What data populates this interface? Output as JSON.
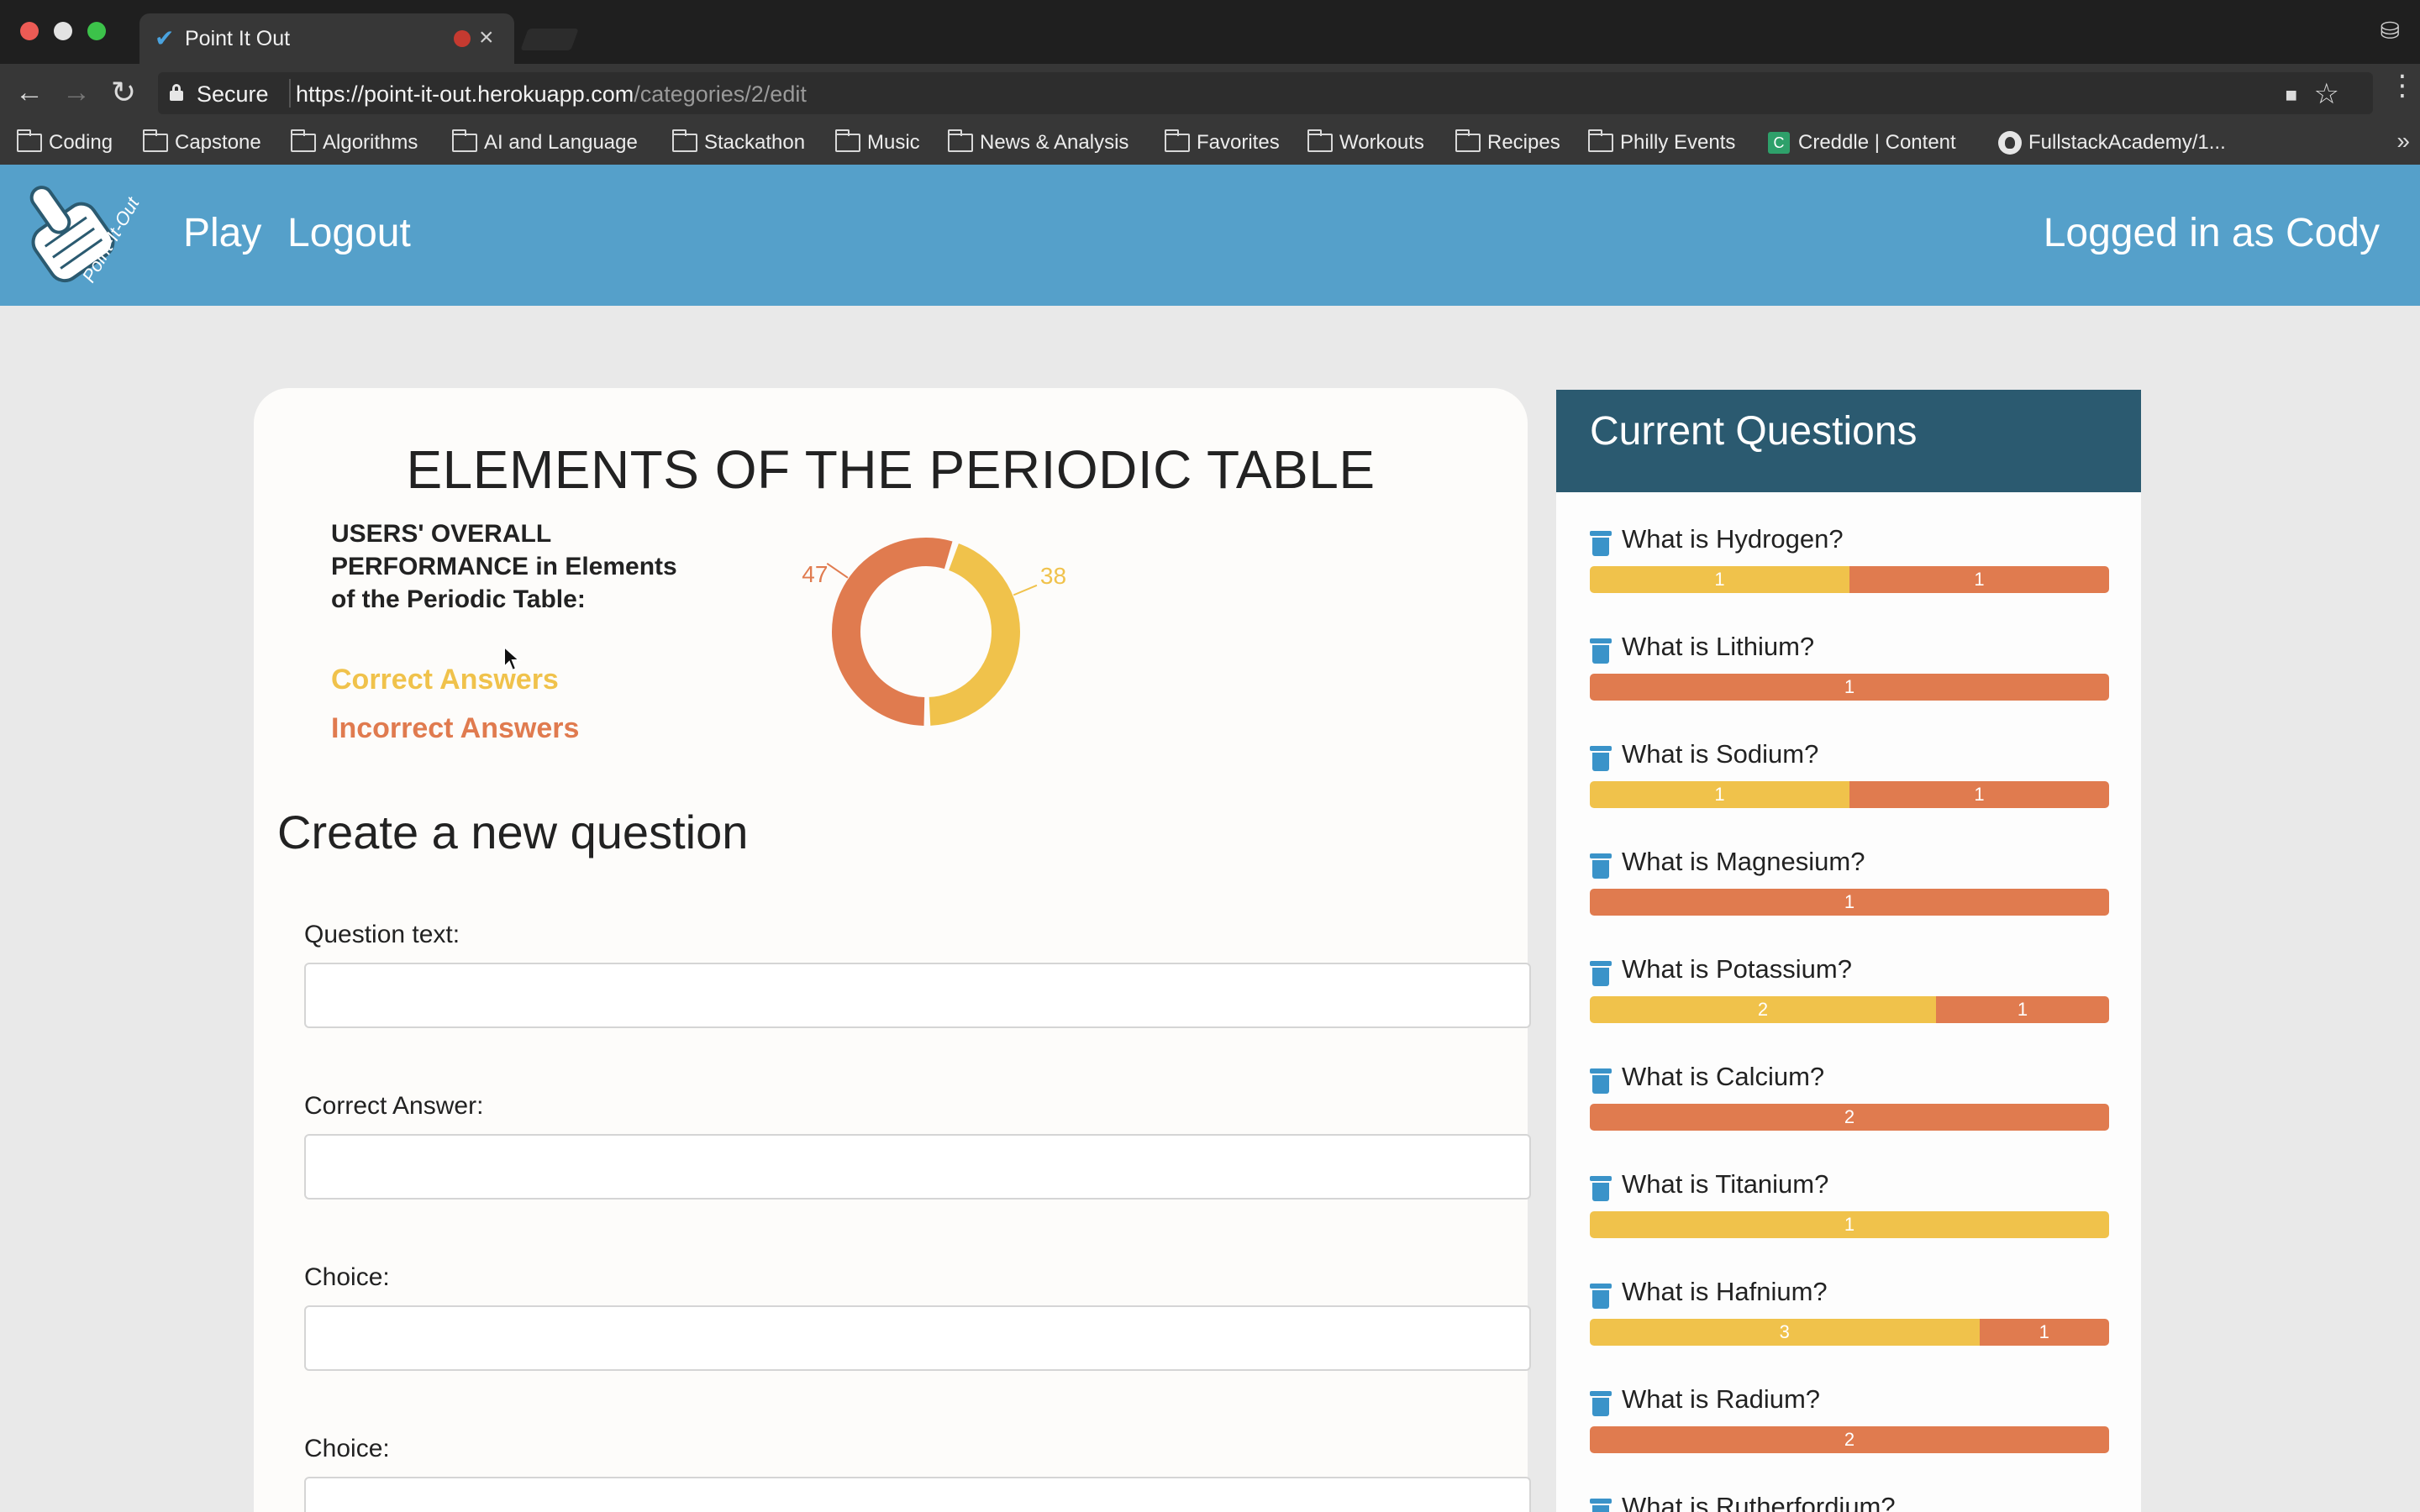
{
  "browser": {
    "tab_title": "Point It Out",
    "secure_label": "Secure",
    "url_host": "https://point-it-out.herokuapp.com",
    "url_path": "/categories/2/edit",
    "bookmarks": [
      {
        "label": "Coding",
        "icon": "folder-icon"
      },
      {
        "label": "Capstone",
        "icon": "folder-icon"
      },
      {
        "label": "Algorithms",
        "icon": "folder-icon"
      },
      {
        "label": "AI and Language",
        "icon": "folder-icon"
      },
      {
        "label": "Stackathon",
        "icon": "folder-icon"
      },
      {
        "label": "Music",
        "icon": "folder-icon"
      },
      {
        "label": "News & Analysis",
        "icon": "folder-icon"
      },
      {
        "label": "Favorites",
        "icon": "folder-icon"
      },
      {
        "label": "Workouts",
        "icon": "folder-icon"
      },
      {
        "label": "Recipes",
        "icon": "folder-icon"
      },
      {
        "label": "Philly Events",
        "icon": "folder-icon"
      },
      {
        "label": "Creddle | Content",
        "icon": "creddle-favicon"
      },
      {
        "label": "FullstackAcademy/1...",
        "icon": "github-favicon"
      }
    ]
  },
  "header": {
    "logo_text": "Point-It-Out",
    "nav_play": "Play",
    "nav_logout": "Logout",
    "logged_in": "Logged in as Cody",
    "bg_color": "#55a0ca"
  },
  "main": {
    "category_title": "ELEMENTS OF THE PERIODIC TABLE",
    "performance_title": "USERS' OVERALL PERFORMANCE in Elements of the Periodic Table:",
    "legend_correct": "Correct Answers",
    "legend_incorrect": "Incorrect Answers",
    "form_heading": "Create a new question",
    "fields": [
      {
        "label": "Question text:",
        "value": ""
      },
      {
        "label": "Correct Answer:",
        "value": ""
      },
      {
        "label": "Choice:",
        "value": ""
      },
      {
        "label": "Choice:",
        "value": ""
      }
    ]
  },
  "chart_data": {
    "type": "pie",
    "style": "donut",
    "labels": [
      "Correct Answers",
      "Incorrect Answers"
    ],
    "values": [
      38,
      47
    ],
    "colors": [
      "#f0c24b",
      "#e07b4f"
    ]
  },
  "side_panel": {
    "title": "Current Questions",
    "questions": [
      {
        "text": "What is Hydrogen?",
        "correct": 1,
        "incorrect": 1
      },
      {
        "text": "What is Lithium?",
        "correct": 0,
        "incorrect": 1
      },
      {
        "text": "What is Sodium?",
        "correct": 1,
        "incorrect": 1
      },
      {
        "text": "What is Magnesium?",
        "correct": 0,
        "incorrect": 1
      },
      {
        "text": "What is Potassium?",
        "correct": 2,
        "incorrect": 1
      },
      {
        "text": "What is Calcium?",
        "correct": 0,
        "incorrect": 2
      },
      {
        "text": "What is Titanium?",
        "correct": 1,
        "incorrect": 0
      },
      {
        "text": "What is Hafnium?",
        "correct": 3,
        "incorrect": 1
      },
      {
        "text": "What is Radium?",
        "correct": 0,
        "incorrect": 2
      },
      {
        "text": "What is Rutherfordium?",
        "correct": 0,
        "incorrect": 0
      }
    ]
  },
  "colors": {
    "correct": "#f0c24b",
    "incorrect": "#e07b4f",
    "panel_header": "#2b5a70"
  }
}
